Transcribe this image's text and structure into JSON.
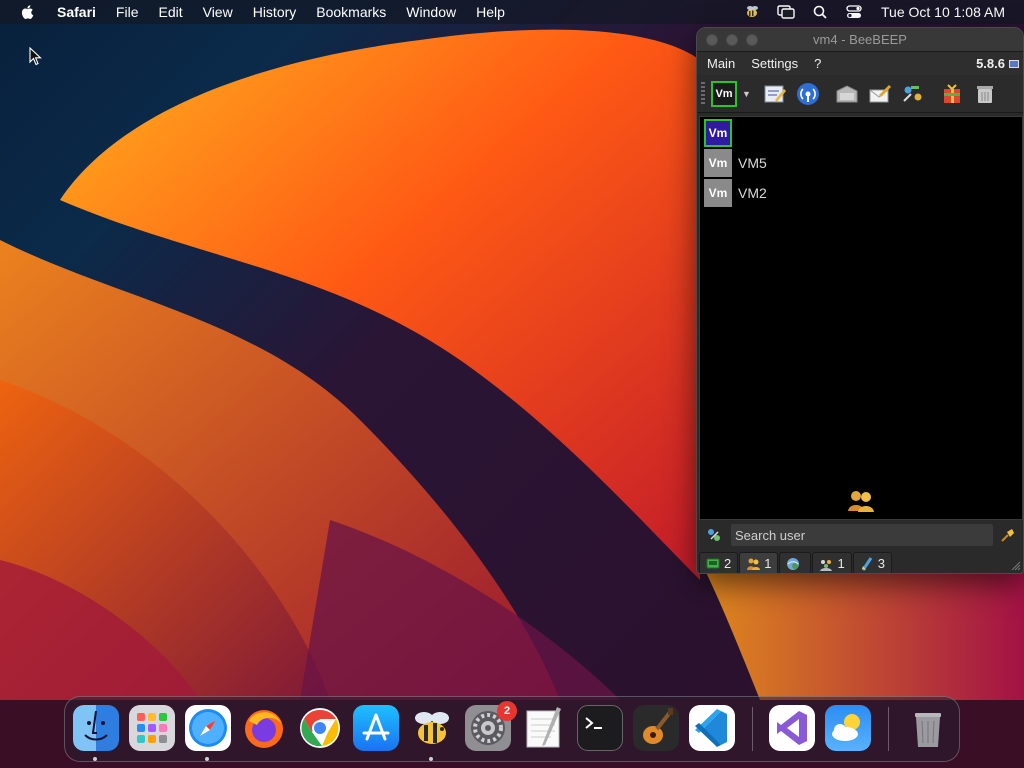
{
  "menubar": {
    "app_name": "Safari",
    "items": [
      "File",
      "Edit",
      "View",
      "History",
      "Bookmarks",
      "Window",
      "Help"
    ],
    "status_icons": [
      "beebeep-icon",
      "screen-mirroring-icon",
      "spotlight-search-icon",
      "control-center-icon"
    ],
    "clock": "Tue Oct 10  1:08 AM"
  },
  "window": {
    "title": "vm4 - BeeBEEP",
    "menu": {
      "main": "Main",
      "settings": "Settings",
      "help": "?"
    },
    "version": "5.8.6",
    "toolbar": {
      "avatar_text": "Vm",
      "buttons": [
        "edit-profile-icon",
        "network-broadcast-icon",
        "file-sharing-icon",
        "write-message-icon",
        "plugins-icon",
        "gift-icon",
        "trash-icon"
      ]
    },
    "users": [
      {
        "avatar": "Vm",
        "name": "",
        "is_self": true
      },
      {
        "avatar": "Vm",
        "name": "VM5",
        "is_self": false
      },
      {
        "avatar": "Vm",
        "name": "VM2",
        "is_self": false
      }
    ],
    "search": {
      "placeholder": "Search user"
    },
    "tabs": [
      {
        "icon": "chat-icon",
        "count": "2"
      },
      {
        "icon": "users-icon",
        "count": "1"
      },
      {
        "icon": "network-icon",
        "count": ""
      },
      {
        "icon": "groups-icon",
        "count": "1"
      },
      {
        "icon": "files-icon",
        "count": "3"
      }
    ]
  },
  "dock": {
    "apps": [
      "finder-icon",
      "launchpad-icon",
      "safari-icon",
      "firefox-icon",
      "chrome-icon",
      "app-store-icon",
      "beebeep-icon",
      "system-settings-icon",
      "textedit-icon",
      "terminal-icon",
      "garageband-icon",
      "vscode-icon",
      "visual-studio-icon",
      "weather-icon",
      "trash-icon"
    ],
    "system_settings_badge": "2"
  },
  "colors": {
    "accent_green": "#2ec22e",
    "self_avatar": "#2e1ba0",
    "badge_red": "#e5372f"
  }
}
